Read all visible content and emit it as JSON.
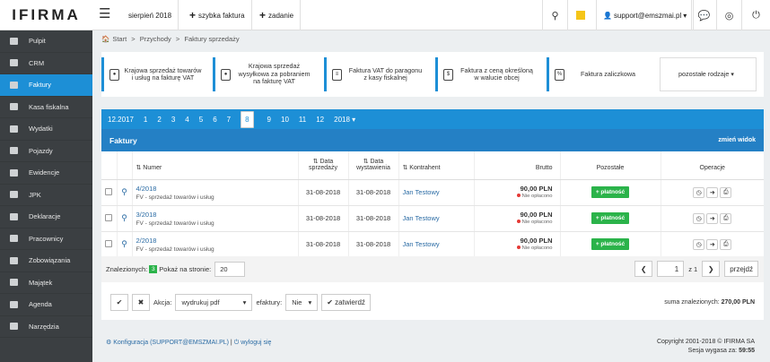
{
  "app": {
    "logo": "IFIRMA"
  },
  "topbar": {
    "period": "sierpień 2018",
    "quick_invoice": "szybka faktura",
    "task": "zadanie",
    "user": "support@emszmai.pl"
  },
  "sidebar": {
    "items": [
      {
        "label": "Pulpit",
        "icon": "dashboard-icon"
      },
      {
        "label": "CRM",
        "icon": "crm-icon"
      },
      {
        "label": "Faktury",
        "icon": "invoice-icon",
        "active": true
      },
      {
        "label": "Kasa fiskalna",
        "icon": "cash-register-icon"
      },
      {
        "label": "Wydatki",
        "icon": "expenses-icon"
      },
      {
        "label": "Pojazdy",
        "icon": "car-icon"
      },
      {
        "label": "Ewidencje",
        "icon": "records-icon"
      },
      {
        "label": "JPK",
        "icon": "jpk-icon"
      },
      {
        "label": "Deklaracje",
        "icon": "declarations-icon"
      },
      {
        "label": "Pracownicy",
        "icon": "employees-icon"
      },
      {
        "label": "Zobowiązania",
        "icon": "liabilities-icon"
      },
      {
        "label": "Majątek",
        "icon": "assets-icon"
      },
      {
        "label": "Agenda",
        "icon": "calendar-icon"
      },
      {
        "label": "Narzędzia",
        "icon": "tools-icon"
      }
    ]
  },
  "breadcrumb": {
    "start": "Start",
    "sep": ">",
    "level1": "Przychody",
    "level2": "Faktury sprzedaży"
  },
  "tiles": [
    "Krajowa sprzedaż towarów i usług na fakturę VAT",
    "Krajowa sprzedaż wysyłkowa za pobraniem na fakturę VAT",
    "Faktura VAT do paragonu z kasy fiskalnej",
    "Faktura z ceną określoną w walucie obcej",
    "Faktura zaliczkowa",
    "pozostałe rodzaje ▾"
  ],
  "months": {
    "year_prev": "12.2017",
    "items": [
      "1",
      "2",
      "3",
      "4",
      "5",
      "6",
      "7",
      "8",
      "9",
      "10",
      "11",
      "12"
    ],
    "selected": "8",
    "year_next": "2018 ▾"
  },
  "panel": {
    "title": "Faktury",
    "change_view": "zmień widok"
  },
  "table": {
    "headers": {
      "number": "⇅ Numer",
      "sale_date": "⇅ Data sprzedaży",
      "issue_date": "⇅ Data wystawienia",
      "contractor": "⇅ Kontrahent",
      "gross": "Brutto",
      "other": "Pozostałe",
      "ops": "Operacje"
    },
    "rows": [
      {
        "number": "4/2018",
        "desc": "FV - sprzedaż towarów i usług",
        "sale_date": "31-08-2018",
        "issue_date": "31-08-2018",
        "contractor": "Jan Testowy",
        "amount": "90,00 PLN",
        "status": "Nie opłacono",
        "pay": "+ płatność"
      },
      {
        "number": "3/2018",
        "desc": "FV - sprzedaż towarów i usług",
        "sale_date": "31-08-2018",
        "issue_date": "31-08-2018",
        "contractor": "Jan Testowy",
        "amount": "90,00 PLN",
        "status": "Nie opłacono",
        "pay": "+ płatność"
      },
      {
        "number": "2/2018",
        "desc": "FV - sprzedaż towarów i usług",
        "sale_date": "31-08-2018",
        "issue_date": "31-08-2018",
        "contractor": "Jan Testowy",
        "amount": "90,00 PLN",
        "status": "Nie opłacono",
        "pay": "+ płatność"
      }
    ]
  },
  "footer": {
    "found": "Znalezionych:",
    "found_count": "3",
    "per_page_label": "Pokaż na stronie:",
    "per_page": "20",
    "page": "1",
    "of": "z 1",
    "next": "przejdź"
  },
  "actions": {
    "label": "Akcja:",
    "action": "wydrukuj pdf",
    "efaktury": "efaktury:",
    "efaktury_val": "Nie",
    "confirm": "zatwierdź",
    "sum_label": "suma znalezionych:",
    "sum_value": "270,00 PLN"
  },
  "bottom": {
    "config": "Konfiguracja (SUPPORT@EMSZMAI.PL)",
    "sep": "|",
    "logout": "wyloguj się",
    "copyright": "Copyright 2001-2018 © IFIRMA SA",
    "session_label": "Sesja wygasa za:",
    "session_time": "59:55"
  },
  "colors": {
    "accent": "#1d8fd6",
    "sidebar": "#3b3f42",
    "success": "#2bb34a",
    "danger": "#e53935"
  }
}
